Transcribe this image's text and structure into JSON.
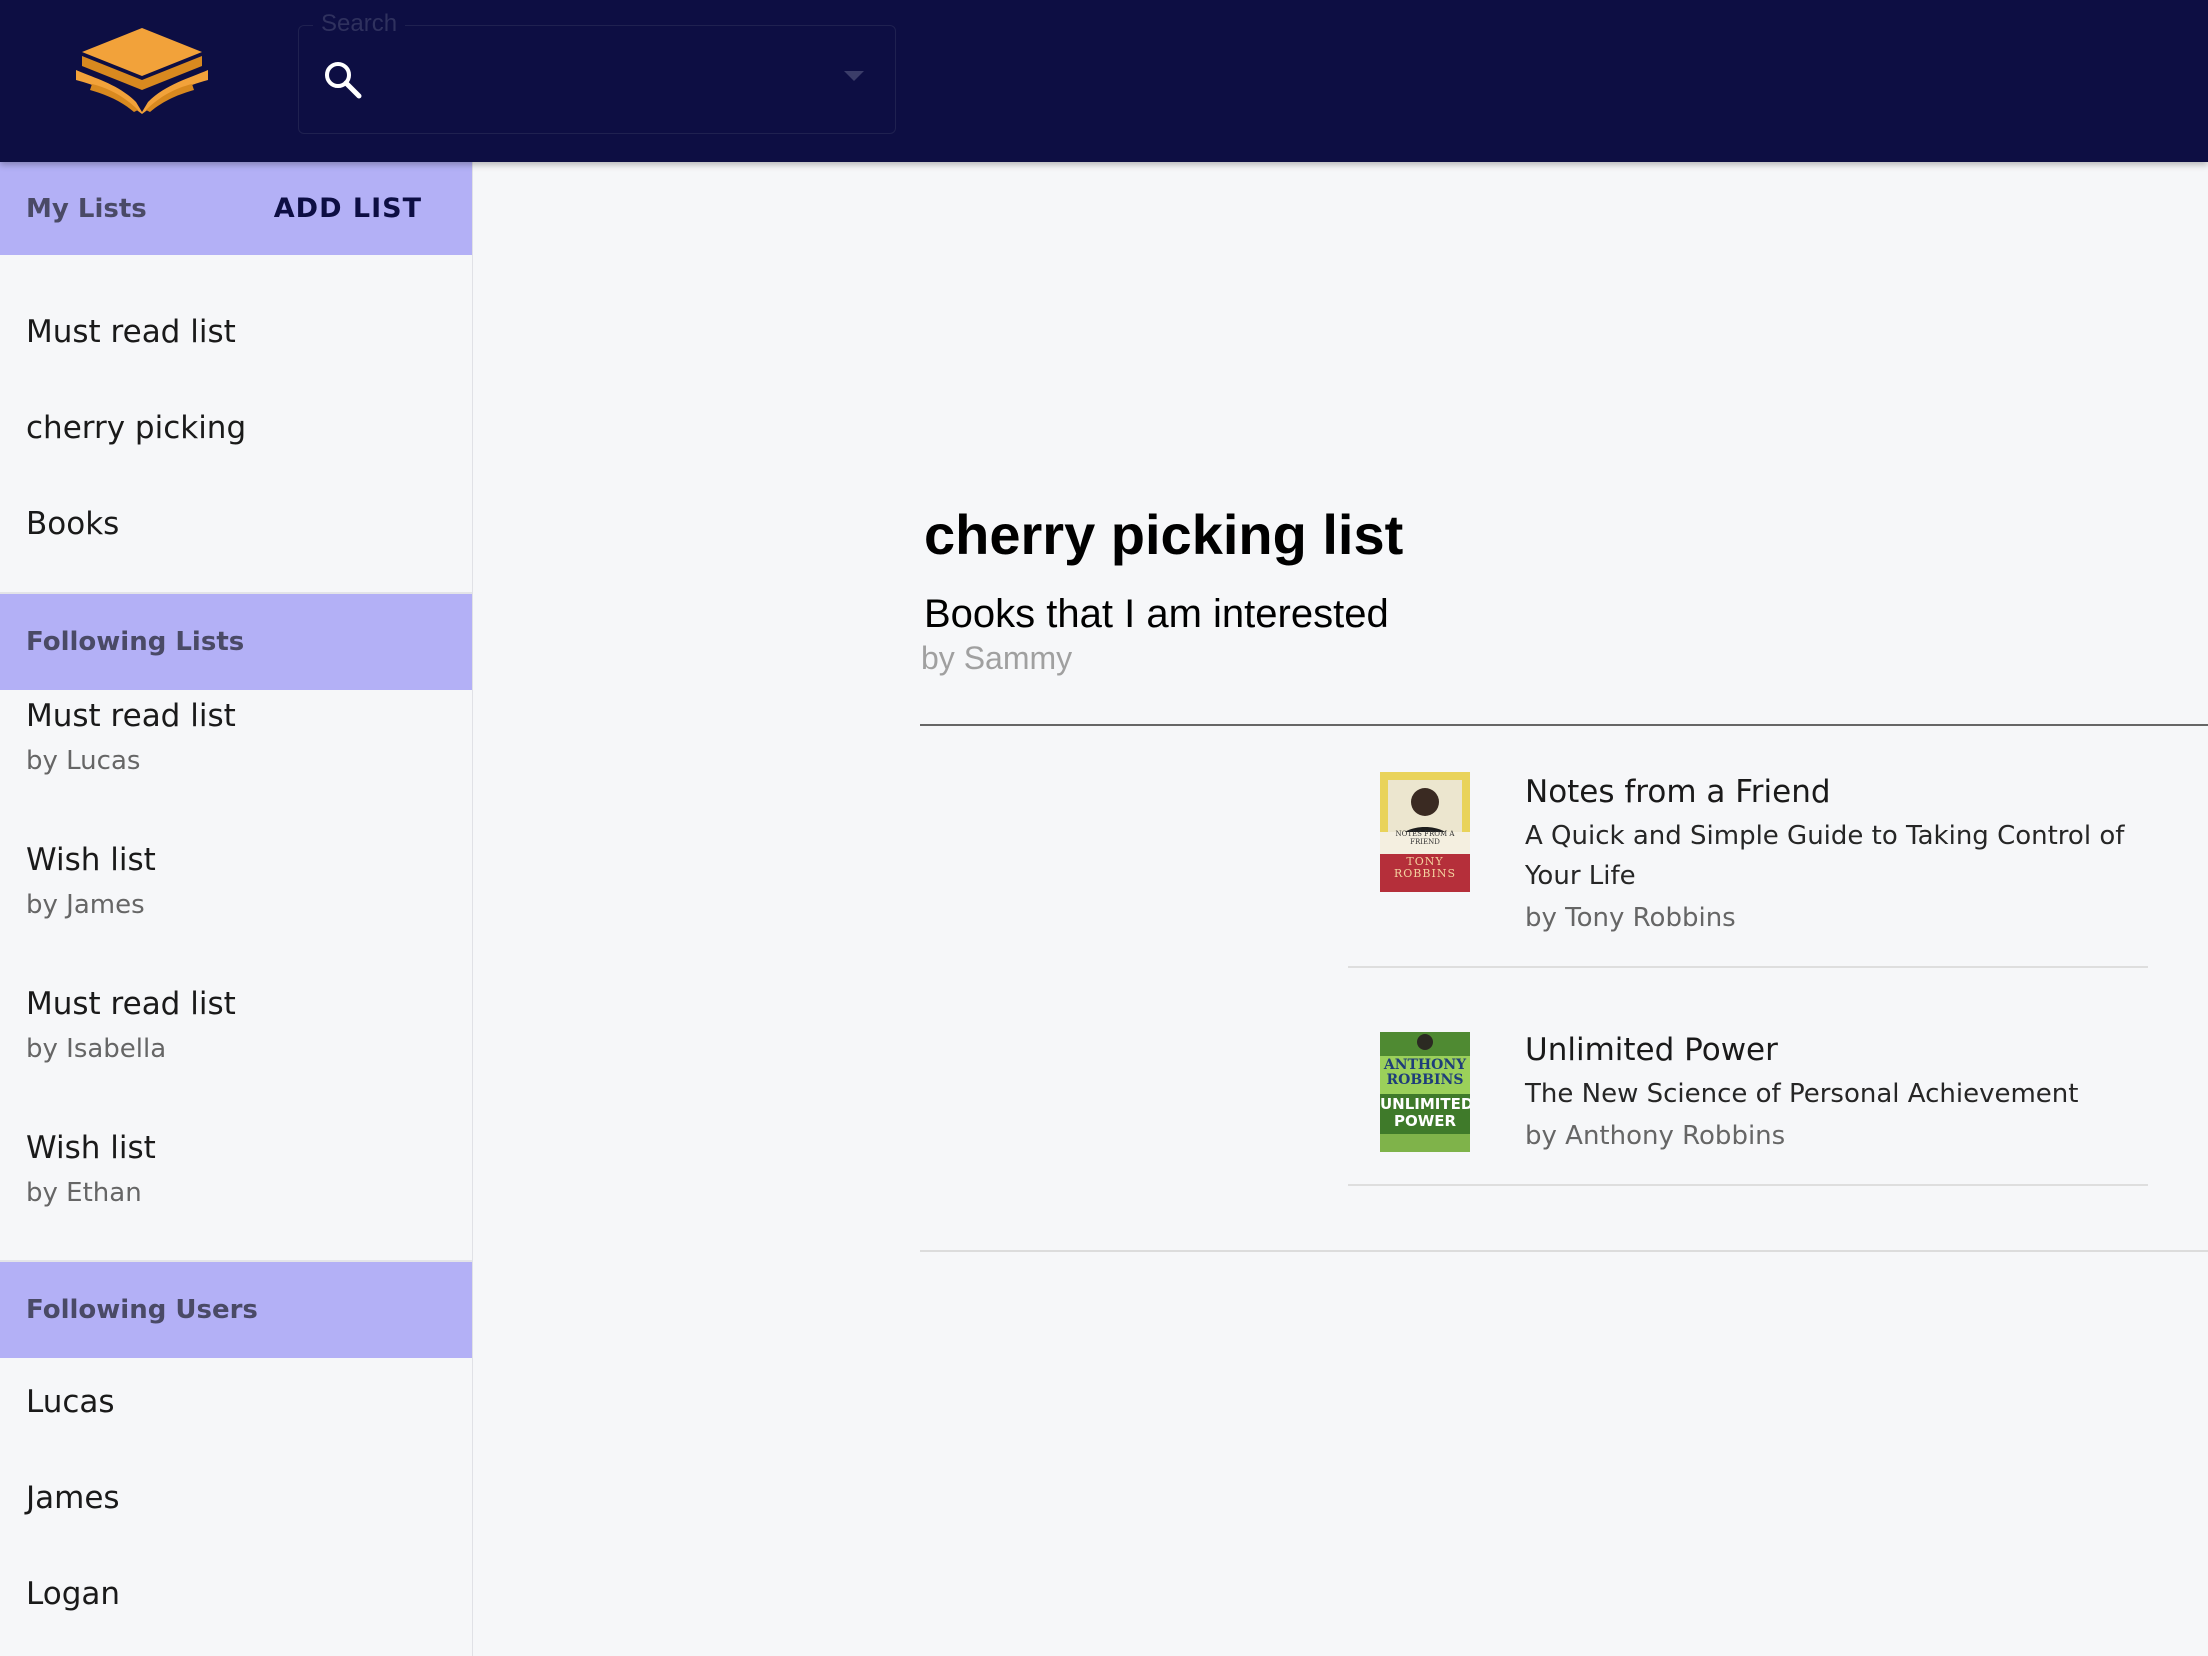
{
  "header": {
    "search": {
      "legend": "Search",
      "value": "",
      "placeholder": ""
    },
    "icons": {
      "logo": "book-stack-logo",
      "search": "search-icon",
      "dropdown": "caret-down-icon"
    }
  },
  "sidebar": {
    "my_lists": {
      "heading": "My Lists",
      "add_label": "ADD LIST",
      "items": [
        {
          "label": "Must read list"
        },
        {
          "label": "cherry picking"
        },
        {
          "label": "Books"
        }
      ]
    },
    "following_lists": {
      "heading": "Following Lists",
      "items": [
        {
          "label": "Must read list",
          "owner": "by Lucas"
        },
        {
          "label": "Wish list",
          "owner": "by James"
        },
        {
          "label": "Must read list",
          "owner": "by Isabella"
        },
        {
          "label": "Wish list",
          "owner": "by Ethan"
        }
      ]
    },
    "following_users": {
      "heading": "Following Users",
      "items": [
        {
          "label": "Lucas"
        },
        {
          "label": "James"
        },
        {
          "label": "Logan"
        }
      ]
    }
  },
  "main": {
    "title": "cherry picking list",
    "description": "Books that I am interested",
    "owner": "by Sammy",
    "books": [
      {
        "title": "Notes from a Friend",
        "subtitle": "A Quick and Simple Guide to Taking Control of Your Life",
        "author": "by Tony Robbins",
        "cover": {
          "top_text": "NOTES FROM A FRIEND",
          "bottom_text": "TONY ROBBINS"
        }
      },
      {
        "title": "Unlimited Power",
        "subtitle": "The New Science of Personal Achievement",
        "author": "by Anthony Robbins",
        "cover": {
          "top_text": "ANTHONY ROBBINS",
          "bottom_text": "UNLIMITED POWER"
        }
      }
    ]
  },
  "colors": {
    "header_bg": "#0d0e43",
    "accent_orange": "#f2a23a",
    "section_bg": "#b3b0f6",
    "page_bg": "#f6f7f9"
  }
}
